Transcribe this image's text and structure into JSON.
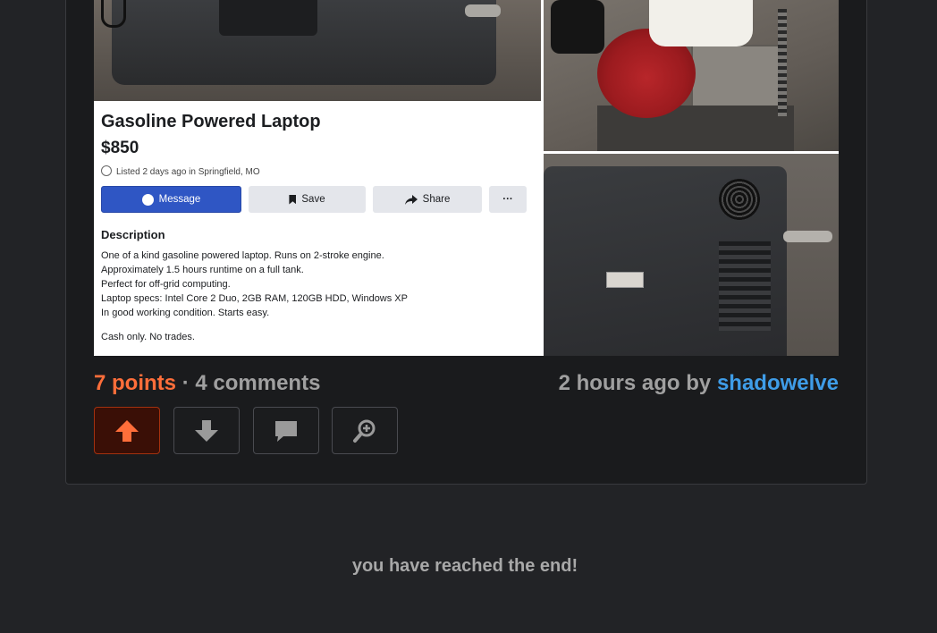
{
  "post": {
    "points_label": "7 points",
    "separator": "·",
    "comments_label": "4 comments",
    "time_prefix": "2 hours ago by",
    "author": "shadowelve"
  },
  "listing": {
    "title": "Gasoline Powered Laptop",
    "price": "$850",
    "meta": "Listed 2 days ago in Springfield, MO",
    "buttons": {
      "message": "Message",
      "save": "Save",
      "share": "Share",
      "more": "···"
    },
    "description_heading": "Description",
    "description_lines": [
      "One of a kind gasoline powered laptop. Runs on 2-stroke engine.",
      "Approximately 1.5 hours runtime on a full tank.",
      "Perfect for off-grid computing.",
      "Laptop specs: Intel Core 2 Duo, 2GB RAM, 120GB HDD, Windows XP",
      "In good working condition. Starts easy."
    ],
    "footer": "Cash only. No trades."
  },
  "actions": {
    "upvote_icon": "arrow-up-icon",
    "downvote_icon": "arrow-down-icon",
    "comment_icon": "comment-icon",
    "zoom_icon": "zoom-in-icon"
  },
  "colors": {
    "points": "#ff6e3a",
    "author": "#3f9de8",
    "upvote_active_bg": "#3a0f06",
    "upvote_active_border": "#a3310f"
  },
  "footer": {
    "end_text": "you have reached the end!"
  }
}
